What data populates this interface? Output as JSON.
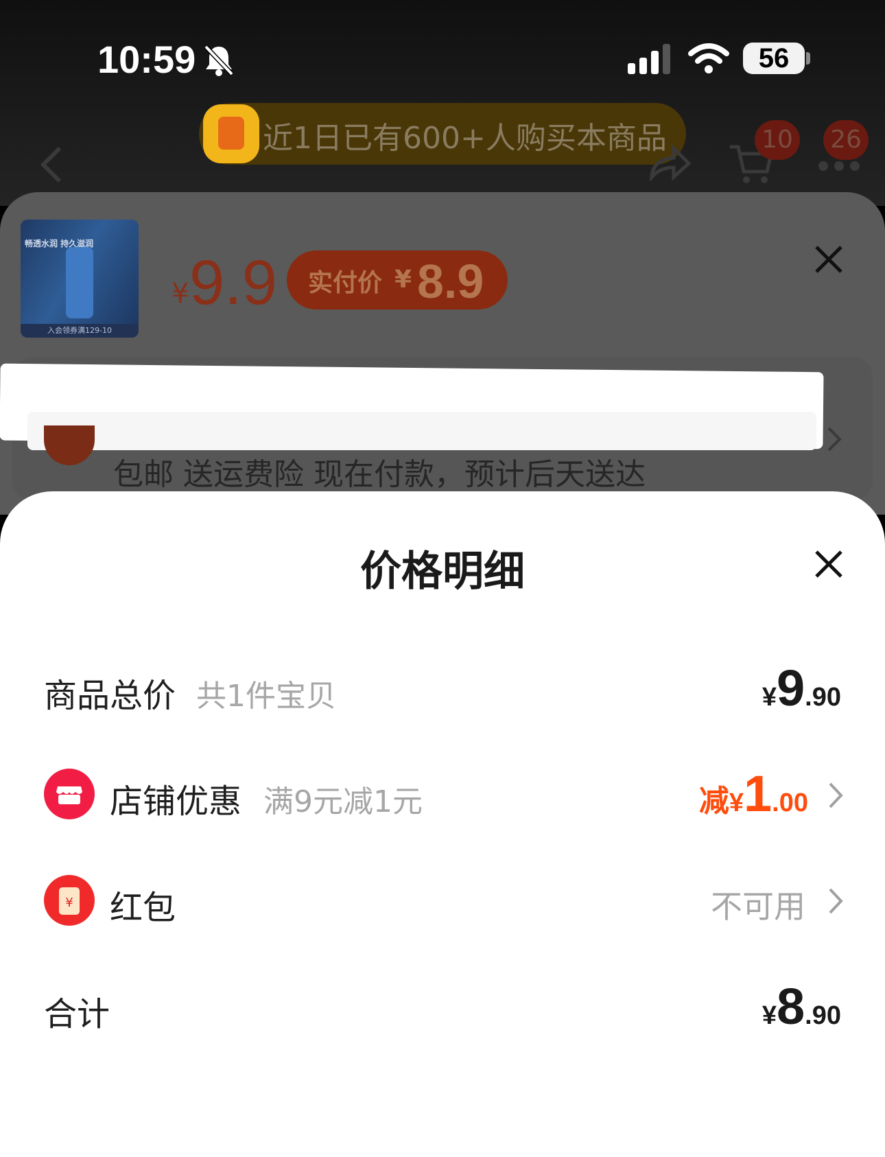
{
  "status_bar": {
    "time": "10:59",
    "battery": "56",
    "icons": [
      "bell-muted-icon",
      "cellular-signal-icon",
      "wifi-icon",
      "battery-icon"
    ]
  },
  "background_page": {
    "promo_text": "近1日已有600+人购买本商品",
    "cart_badge": "10",
    "more_badge": "26",
    "product": {
      "thumb_headline": "畅透水润 持久滋润",
      "thumb_footer": "入会领券满129-10",
      "price_yen": "¥",
      "price": "9.9",
      "pay_label": "实付价",
      "pay_yen": "¥",
      "pay_price": "8.9"
    },
    "shipping": "包邮 送运费险 现在付款，预计后天送达"
  },
  "price_detail": {
    "title": "价格明细",
    "rows": [
      {
        "label": "商品总价",
        "sub": "共1件宝贝",
        "yen": "¥",
        "int": "9",
        "dec": ".90"
      },
      {
        "label": "店铺优惠",
        "sub": "满9元减1元",
        "prefix": "减",
        "yen": "¥",
        "int": "1",
        "dec": ".00"
      },
      {
        "label": "红包",
        "status": "不可用"
      },
      {
        "label": "合计",
        "yen": "¥",
        "int": "8",
        "dec": ".90"
      }
    ]
  },
  "colors": {
    "accent_red": "#ff4d0d",
    "store_icon": "#f21d44",
    "redpacket_icon": "#f02a2a"
  }
}
